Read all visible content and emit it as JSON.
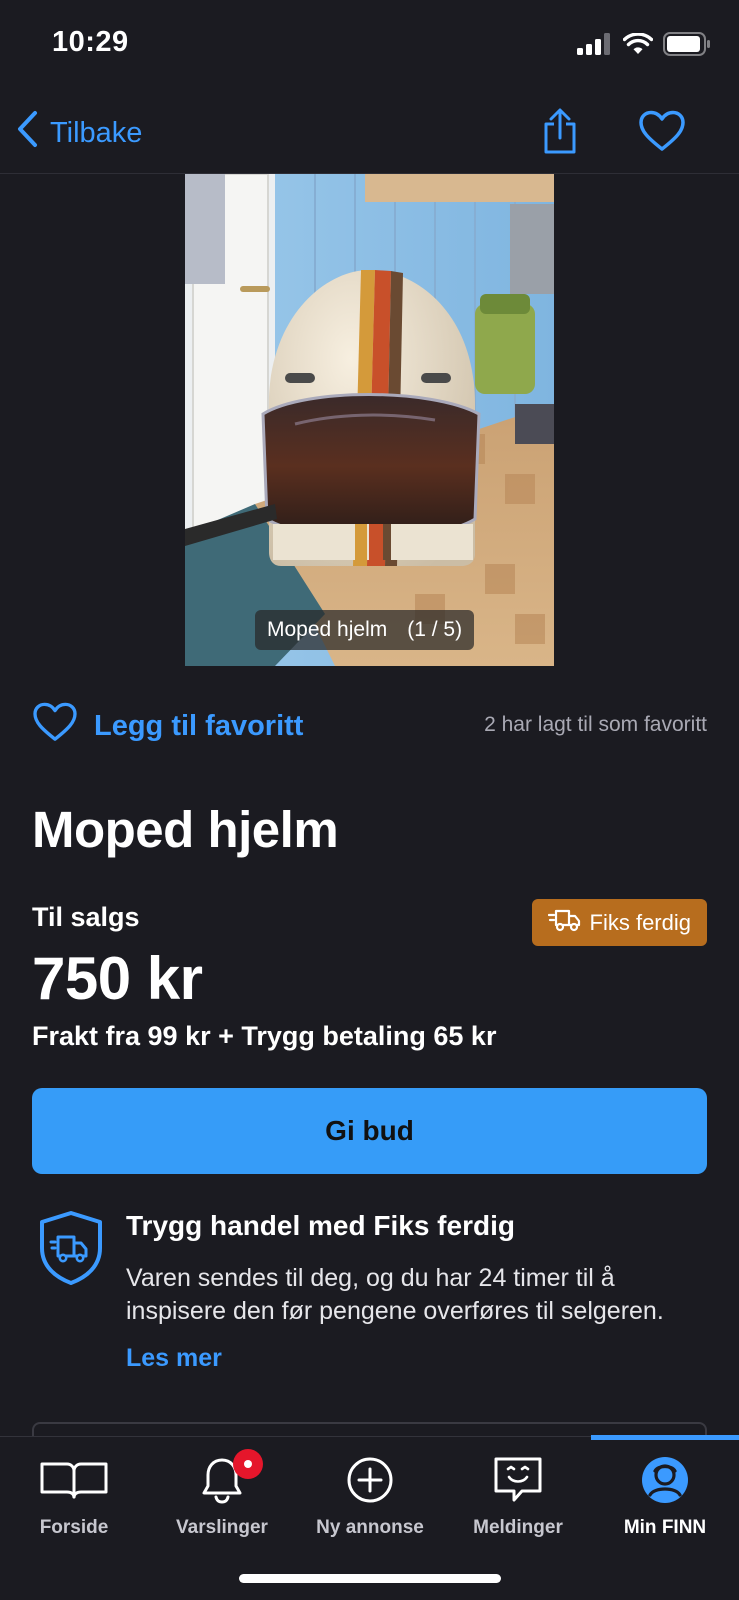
{
  "status_bar": {
    "time": "10:29"
  },
  "nav": {
    "back_label": "Tilbake"
  },
  "photo": {
    "caption_title": "Moped hjelm",
    "caption_counter": "(1 / 5)"
  },
  "favorite": {
    "label": "Legg til favoritt",
    "count_text": "2 har lagt til som favoritt"
  },
  "listing": {
    "title": "Moped hjelm",
    "status": "Til salgs",
    "badge": "Fiks ferdig",
    "price": "750 kr",
    "shipping": "Frakt fra 99 kr + Trygg betaling 65 kr",
    "bid_button": "Gi bud"
  },
  "safe_trade": {
    "title": "Trygg handel med Fiks ferdig",
    "body": "Varen sendes til deg, og du har 24 timer til å inspisere den før pengene overføres til selgeren.",
    "link": "Les mer"
  },
  "tabs": [
    {
      "label": "Forside",
      "icon": "book-icon"
    },
    {
      "label": "Varslinger",
      "icon": "bell-icon"
    },
    {
      "label": "Ny annonse",
      "icon": "plus-circle-icon"
    },
    {
      "label": "Meldinger",
      "icon": "message-icon"
    },
    {
      "label": "Min FINN",
      "icon": "profile-icon"
    }
  ],
  "colors": {
    "accent": "#3b9aff",
    "button": "#369cf8",
    "badge": "#b76d1e",
    "background": "#1b1b21",
    "notification": "#e5162b"
  }
}
